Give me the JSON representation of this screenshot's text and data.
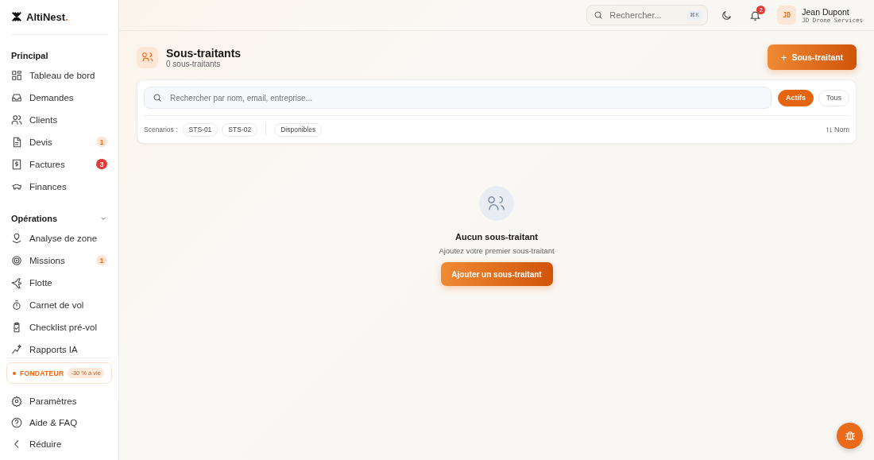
{
  "brand": {
    "name": "AltiNest",
    "dot": "."
  },
  "sidebar": {
    "sections": [
      {
        "title": "Principal",
        "collapsible": false,
        "items": [
          {
            "label": "Tableau de bord"
          },
          {
            "label": "Demandes"
          },
          {
            "label": "Clients"
          },
          {
            "label": "Devis",
            "badge": "1",
            "color": "#fde6d6"
          },
          {
            "label": "Factures",
            "badge": "3",
            "color": "#e53935"
          },
          {
            "label": "Finances"
          }
        ]
      },
      {
        "title": "Opérations",
        "collapsible": true,
        "items": [
          {
            "label": "Analyse de zone"
          },
          {
            "label": "Missions",
            "badge": "1",
            "color": "#fde6d6"
          },
          {
            "label": "Flotte"
          },
          {
            "label": "Carnet de vol"
          },
          {
            "label": "Checklist pré-vol"
          },
          {
            "label": "Rapports IA"
          }
        ]
      }
    ],
    "promo": {
      "label": "FONDATEUR",
      "tag": "-30 % à vie"
    },
    "footer": [
      {
        "label": "Paramètres"
      },
      {
        "label": "Aide & FAQ"
      },
      {
        "label": "Réduire"
      }
    ]
  },
  "topbar": {
    "search_placeholder": "Rechercher...",
    "shortcut": "⌘K",
    "notifications": "2",
    "user": {
      "initials": "JD",
      "name": "Jean Dupont",
      "company": "JD Drone Services"
    }
  },
  "page": {
    "title": "Sous-traitants",
    "subtitle": "0 sous-traitants",
    "add_button": "Sous-traitant",
    "add_icon": "+"
  },
  "filters": {
    "search_placeholder": "Rechercher par nom, email, entreprise...",
    "status": [
      {
        "label": "Actifs",
        "selected": true
      },
      {
        "label": "Tous",
        "selected": false
      }
    ],
    "scenarios_label": "Scenarios :",
    "scenarios": [
      {
        "label": "STS-01",
        "selected": false
      },
      {
        "label": "STS-02",
        "selected": false
      }
    ],
    "availability": [
      {
        "label": "Disponibles",
        "selected": false
      }
    ],
    "sort": "Nom"
  },
  "empty": {
    "title": "Aucun sous-traitant",
    "text": "Ajoutez votre premier sous-traitant",
    "button": "Ajouter un sous-traitant"
  }
}
